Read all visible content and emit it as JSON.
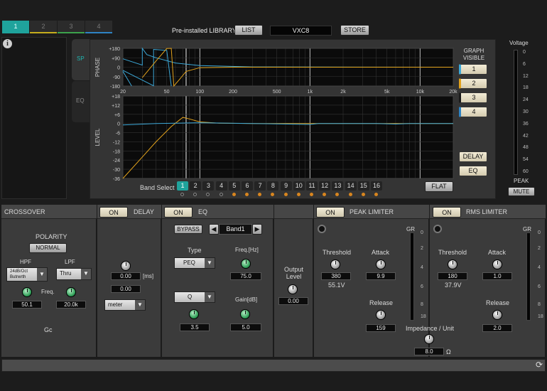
{
  "tabs": [
    "1",
    "2",
    "3",
    "4"
  ],
  "tab_colors": [
    "#1fa39c",
    "#c6ad1c",
    "#3ca24c",
    "#2e83c4"
  ],
  "library": {
    "label": "Pre-installed LIBRARY",
    "list_button": "LIST",
    "name": "VXC8",
    "store_button": "STORE"
  },
  "side_tabs": {
    "sp": "SP",
    "eq": "EQ"
  },
  "graph": {
    "phase_label": "PHASE",
    "level_label": "LEVEL",
    "phase_ticks": [
      "+180",
      "+90",
      "0",
      "-90",
      "-180"
    ],
    "level_ticks": [
      "+18",
      "+12",
      "+6",
      "0",
      "-6",
      "-12",
      "-18",
      "-24",
      "-30",
      "-36"
    ],
    "freq_ticks": [
      "20",
      "50",
      "100",
      "200",
      "500",
      "1k",
      "2k",
      "5k",
      "10k",
      "20k"
    ]
  },
  "graph_visible": {
    "label_line1": "GRAPH",
    "label_line2": "VISIBLE",
    "buttons": [
      "1",
      "2",
      "3",
      "4"
    ],
    "colors": [
      "#3ca8d8",
      "#e2a21c",
      "#1a1a1a",
      "#2e83c4"
    ],
    "delay_button": "DELAY",
    "eq_button": "EQ"
  },
  "band_select": {
    "label": "Band Select",
    "bands": [
      "1",
      "2",
      "3",
      "4",
      "5",
      "6",
      "7",
      "8",
      "9",
      "10",
      "11",
      "12",
      "13",
      "14",
      "15",
      "16"
    ],
    "selected": "1",
    "flat_button": "FLAT"
  },
  "voltage_meter": {
    "title": "Voltage",
    "ticks": [
      "0",
      "6",
      "12",
      "18",
      "24",
      "30",
      "36",
      "42",
      "48",
      "54",
      "60"
    ],
    "peak_label": "PEAK",
    "mute_button": "MUTE"
  },
  "crossover": {
    "title": "CROSSOVER",
    "polarity_label": "POLARITY",
    "polarity_value": "NORMAL",
    "hpf_label": "HPF",
    "lpf_label": "LPF",
    "hpf_type": "24dB/Oct Butrwrth",
    "lpf_type": "Thru",
    "freq_label": "Freq.",
    "hpf_freq": "50.1",
    "lpf_freq": "20.0k",
    "gc_label": "Gc"
  },
  "delay": {
    "on_label": "ON",
    "title": "DELAY",
    "value": "0.00",
    "unit": "[ms]",
    "value2": "0.00",
    "mode": "meter"
  },
  "eq": {
    "on_label": "ON",
    "title": "EQ",
    "bypass_label": "BYPASS",
    "band": "Band1",
    "type_label": "Type",
    "type_value": "PEQ",
    "freq_label": "Freq.[Hz]",
    "freq_value": "75.0",
    "q_label": "Q",
    "q_value": "3.5",
    "gain_label": "Gain[dB]",
    "gain_value": "5.0"
  },
  "output": {
    "label_line1": "Output",
    "label_line2": "Level",
    "value": "0.00"
  },
  "peak_limiter": {
    "on_label": "ON",
    "title": "PEAK LIMITER",
    "gr_label": "GR",
    "gr_ticks": [
      "0",
      "2",
      "4",
      "6",
      "8",
      "18"
    ],
    "threshold_label": "Threshold",
    "threshold_value": "380",
    "threshold_volt": "55.1V",
    "attack_label": "Attack",
    "attack_value": "9.9",
    "release_label": "Release",
    "release_value": "159"
  },
  "rms_limiter": {
    "on_label": "ON",
    "title": "RMS LIMITER",
    "gr_label": "GR",
    "gr_ticks": [
      "0",
      "2",
      "4",
      "6",
      "8",
      "18"
    ],
    "threshold_label": "Threshold",
    "threshold_value": "180",
    "threshold_volt": "37.9V",
    "attack_label": "Attack",
    "attack_value": "1.0",
    "release_label": "Release",
    "release_value": "2.0"
  },
  "impedance": {
    "label": "Impedance / Unit",
    "value": "8.0",
    "unit": "Ω"
  }
}
